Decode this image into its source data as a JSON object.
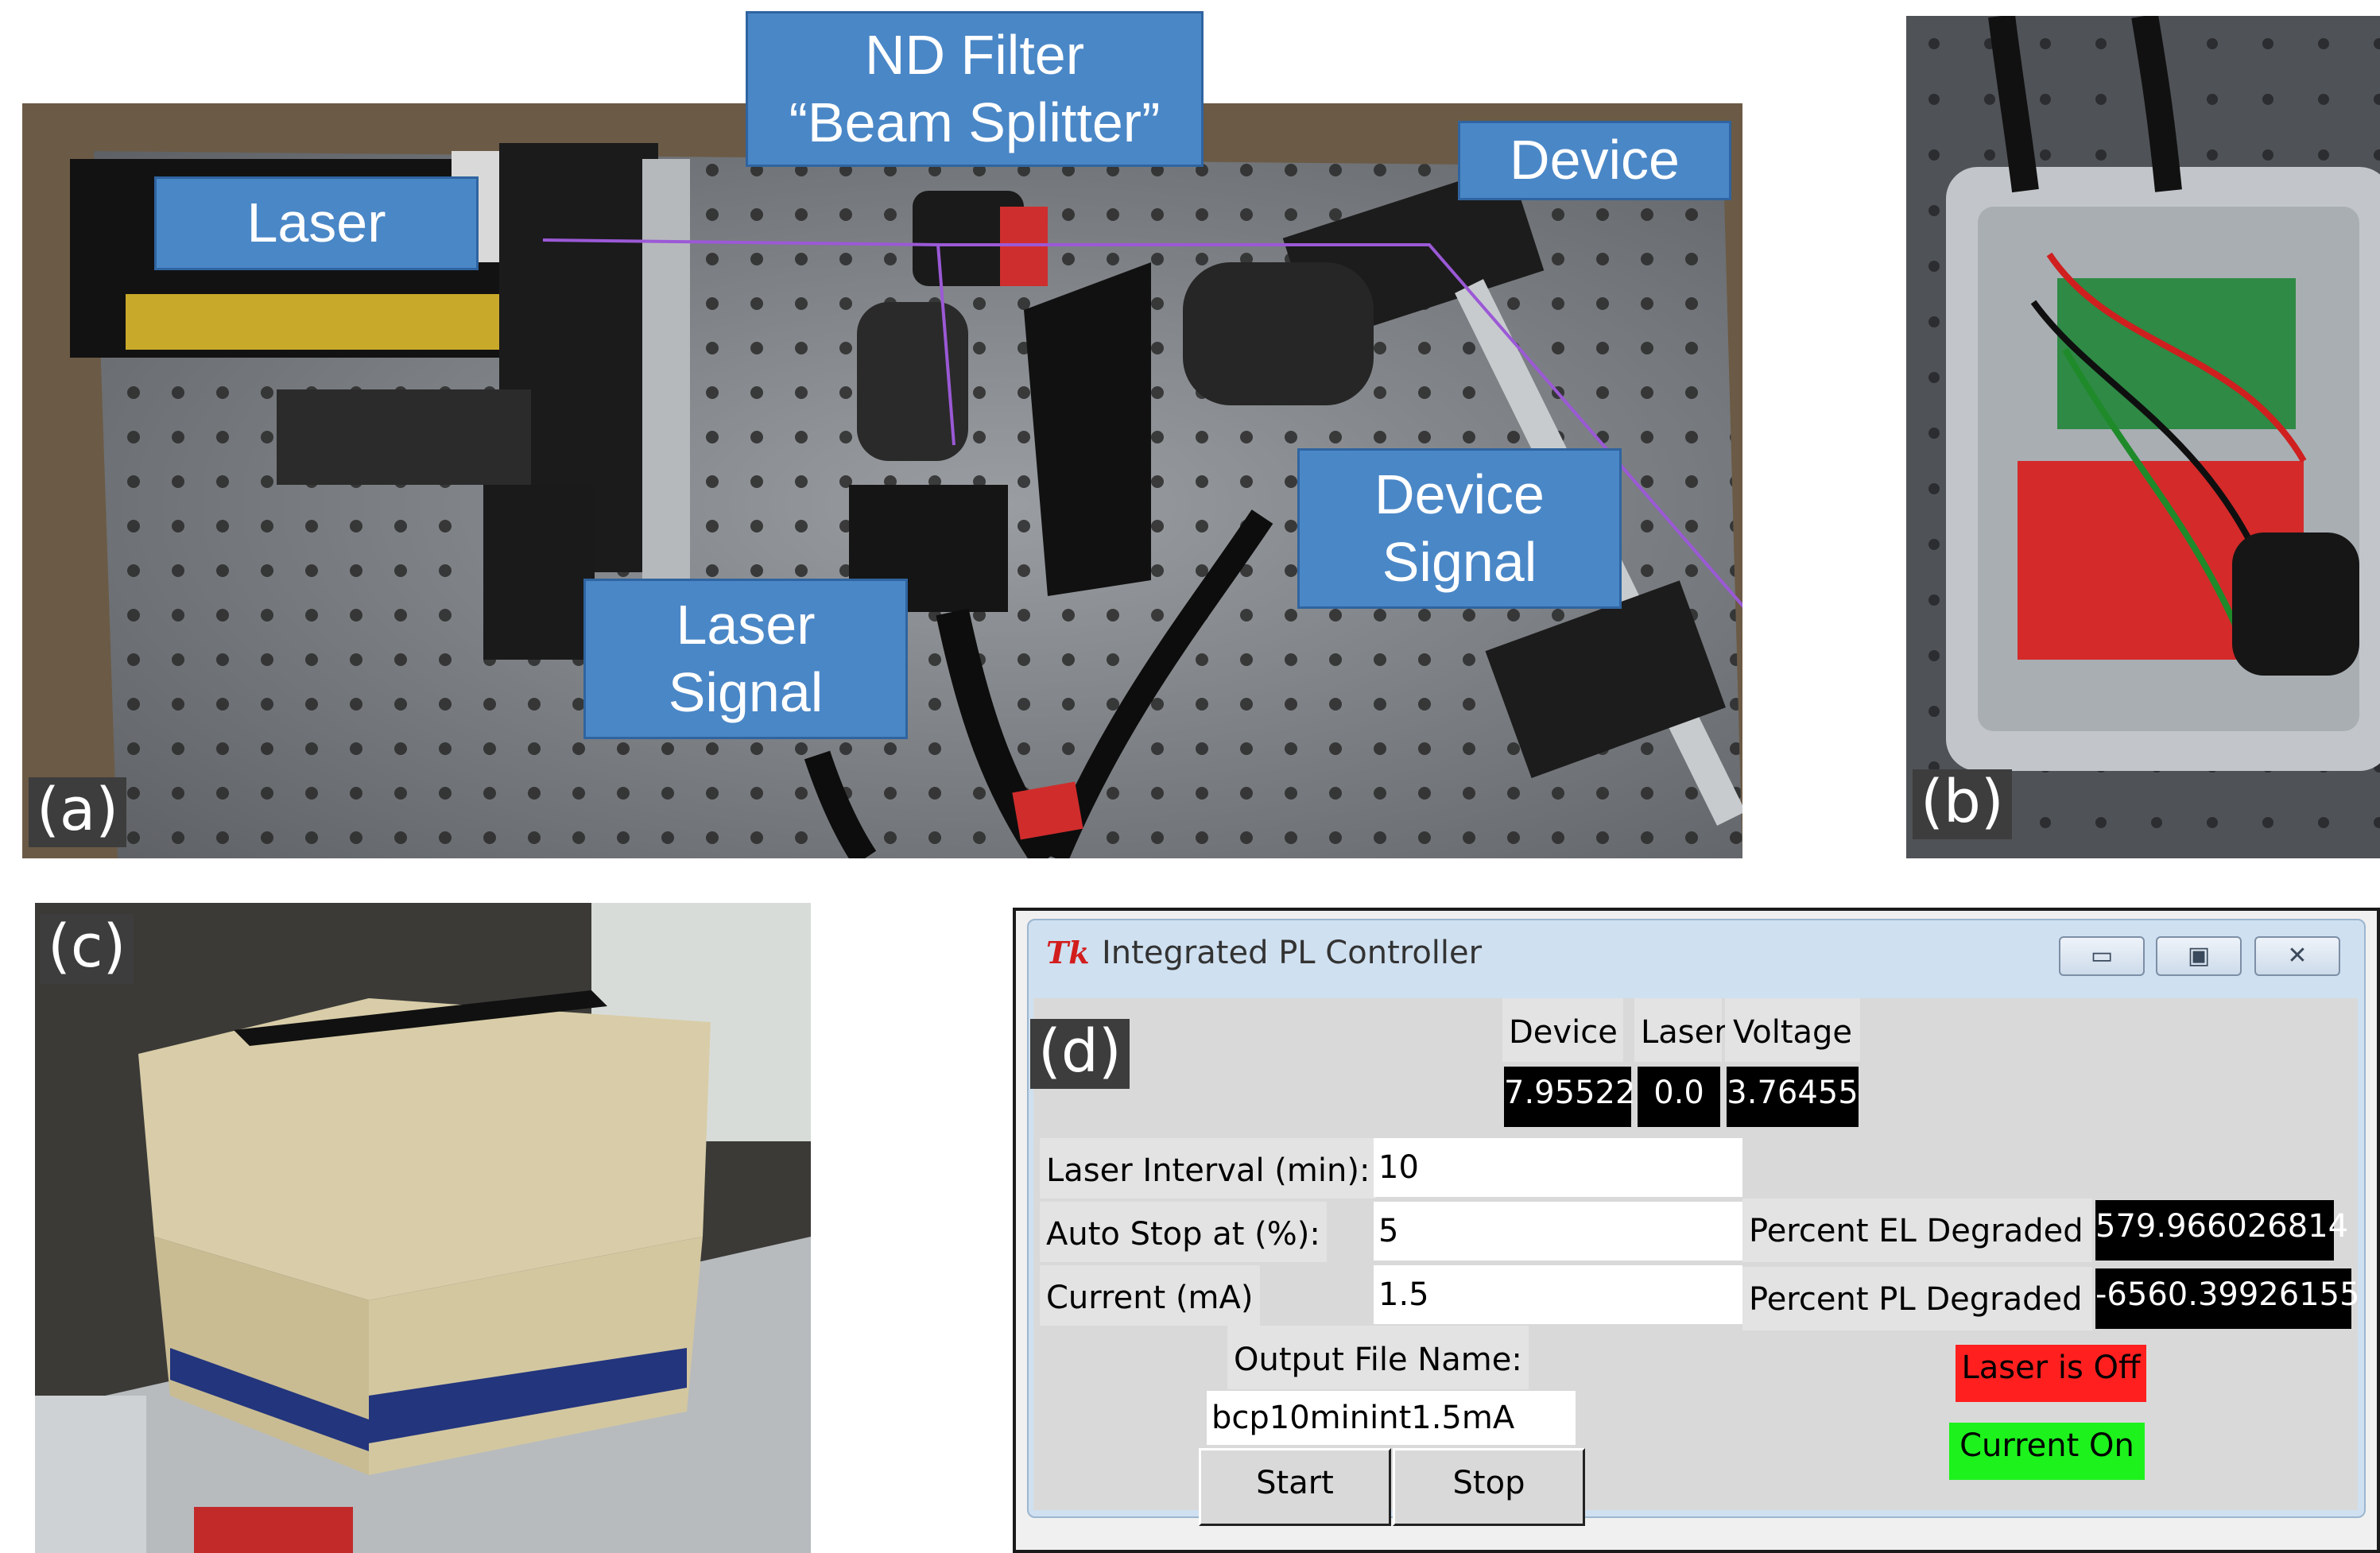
{
  "figure": {
    "panel_a": {
      "letter": "(a)",
      "callouts": {
        "nd_filter_line1": "ND Filter",
        "nd_filter_line2": "“Beam Splitter”",
        "laser": "Laser",
        "device": "Device",
        "device_signal_line1": "Device",
        "device_signal_line2": "Signal",
        "laser_signal_line1": "Laser",
        "laser_signal_line2": "Signal"
      },
      "beam_color": "#9b59d6"
    },
    "panel_b": {
      "letter": "(b)"
    },
    "panel_c": {
      "letter": "(c)"
    },
    "panel_d": {
      "letter": "(d)"
    }
  },
  "window": {
    "logo": "Tk",
    "title": "Integrated PL Controller",
    "controls": {
      "minimize": "▭",
      "maximize": "▣",
      "close": "✕"
    },
    "readouts": {
      "device_header": "Device",
      "laser_header": "Laser",
      "voltage_header": "Voltage",
      "device_value": "7.95522",
      "laser_value": "0.0",
      "voltage_value": "3.76455"
    },
    "form": {
      "laser_interval_label": "Laser Interval (min):",
      "laser_interval_value": "10",
      "auto_stop_label": "Auto Stop at (%):",
      "auto_stop_value": "5",
      "current_label": "Current (mA)",
      "current_value": "1.5",
      "output_file_label": "Output File Name:",
      "output_file_value": "bcp10minint1.5mA"
    },
    "degradation": {
      "el_label": "Percent EL Degraded",
      "el_value": "579.966026814",
      "pl_label": "Percent PL Degraded",
      "pl_value": "-6560.39926155"
    },
    "status": {
      "laser": "Laser is Off",
      "laser_color": "#ff1f1f",
      "current": "Current On",
      "current_color": "#1df21d"
    },
    "buttons": {
      "start": "Start",
      "stop": "Stop"
    }
  }
}
